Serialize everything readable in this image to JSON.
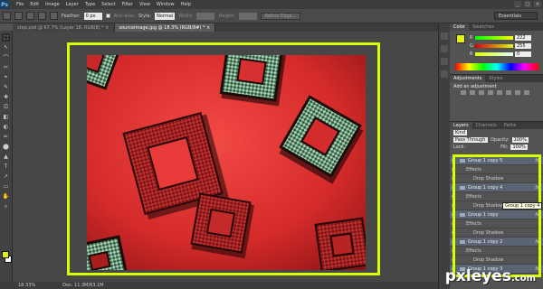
{
  "app": {
    "logo": "Ps"
  },
  "menu": [
    "File",
    "Edit",
    "Image",
    "Layer",
    "Type",
    "Select",
    "Filter",
    "View",
    "Window",
    "Help"
  ],
  "window_controls": [
    "_",
    "□",
    "×"
  ],
  "options": {
    "feather_label": "Feather:",
    "feather_value": "0 px",
    "antialias_label": "Anti-alias",
    "style_label": "Style:",
    "style_value": "Normal",
    "width_label": "Width:",
    "height_label": "Height:",
    "refine_button": "Refine Edge...",
    "workspace": "Essentials"
  },
  "tabs": [
    {
      "label": "step.psd @ 67.7% (Layer 18, RGB/8) *  ×",
      "active": false
    },
    {
      "label": "sourceimage.jpg @ 18.3% (RGB/8#) *  ×",
      "active": true
    }
  ],
  "tools": [
    "⬚",
    "↖",
    "⌒",
    "✂",
    "⌖",
    "✎",
    "✚",
    "⎚",
    "◧",
    "◐",
    "✏",
    "⬤",
    "▲",
    "T",
    "↗",
    "▭",
    "✋",
    "⌕"
  ],
  "status": {
    "zoom": "18.33%",
    "doc": "Doc: 11.3M/63.1M"
  },
  "color_panel": {
    "tabs": [
      "Color",
      "Swatches"
    ],
    "channels": [
      {
        "name": "R",
        "value": "222"
      },
      {
        "name": "G",
        "value": "255"
      },
      {
        "name": "B",
        "value": "0"
      }
    ]
  },
  "adjustments": {
    "tabs": [
      "Adjustments",
      "Styles"
    ],
    "title": "Add an adjustment"
  },
  "layers_panel": {
    "tabs": [
      "Layers",
      "Channels",
      "Paths"
    ],
    "kind": "Kind",
    "blend": "Pass Through",
    "opacity_label": "Opacity:",
    "opacity_value": "100%",
    "lock_label": "Lock:",
    "fill_label": "Fill:",
    "fill_value": "100%",
    "layers": [
      {
        "name": "Group 1 copy 5",
        "type": "group",
        "fx": "fx"
      },
      {
        "name": "Effects",
        "type": "sub"
      },
      {
        "name": "Drop Shadow",
        "type": "sub2"
      },
      {
        "name": "Group 1 copy 4",
        "type": "group",
        "fx": "fx"
      },
      {
        "name": "Effects",
        "type": "sub"
      },
      {
        "name": "Drop Shadow",
        "type": "sub2"
      },
      {
        "name": "Group 1 copy",
        "type": "group",
        "fx": "fx"
      },
      {
        "name": "Effects",
        "type": "sub"
      },
      {
        "name": "Drop Shadow",
        "type": "sub2"
      },
      {
        "name": "Group 1 copy 2",
        "type": "group",
        "fx": "fx"
      },
      {
        "name": "Effects",
        "type": "sub"
      },
      {
        "name": "Drop Shadow",
        "type": "sub2"
      },
      {
        "name": "Group 1 copy 3",
        "type": "group",
        "fx": "fx"
      }
    ],
    "tooltip": "Group 1 copy 4"
  },
  "watermark": {
    "main": "pxleyes",
    "suffix": ".com"
  },
  "colors": {
    "highlight": "#d7ff00",
    "foreground": "#e6f200"
  }
}
